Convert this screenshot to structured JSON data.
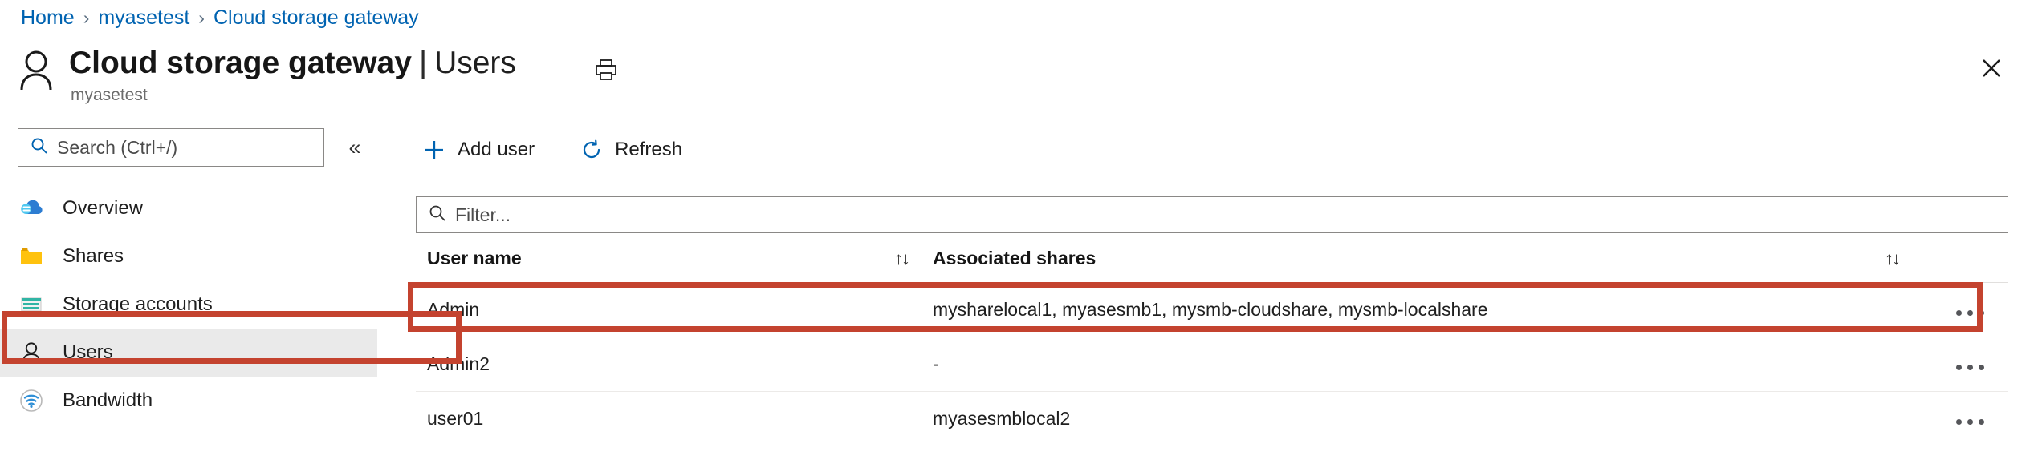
{
  "breadcrumb": {
    "items": [
      {
        "label": "Home"
      },
      {
        "label": "myasetest"
      },
      {
        "label": "Cloud storage gateway"
      }
    ],
    "separator": "›"
  },
  "header": {
    "resource_icon": "person-icon",
    "title": "Cloud storage gateway",
    "title_separator": "|",
    "page_name": "Users",
    "subtitle": "myasetest",
    "print_icon": "print-icon",
    "close_icon": "close-icon"
  },
  "sidebar": {
    "search": {
      "placeholder": "Search (Ctrl+/)",
      "icon": "search-icon"
    },
    "collapse_icon": "«",
    "items": [
      {
        "label": "Overview",
        "icon": "cloud-icon",
        "selected": false
      },
      {
        "label": "Shares",
        "icon": "folder-icon",
        "selected": false
      },
      {
        "label": "Storage accounts",
        "icon": "storage-account-icon",
        "selected": false
      },
      {
        "label": "Users",
        "icon": "person-icon",
        "selected": true
      },
      {
        "label": "Bandwidth",
        "icon": "bandwidth-icon",
        "selected": false
      }
    ]
  },
  "toolbar": {
    "add_user_label": "Add user",
    "add_user_icon": "plus-icon",
    "refresh_label": "Refresh",
    "refresh_icon": "refresh-icon"
  },
  "filter": {
    "placeholder": "Filter...",
    "icon": "search-icon"
  },
  "table": {
    "columns": [
      {
        "label": "User name",
        "sort_icon": "↑↓"
      },
      {
        "label": "Associated shares",
        "sort_icon": "↑↓"
      }
    ],
    "row_menu_icon": "more-options-icon",
    "rows": [
      {
        "user_name": "Admin",
        "associated_shares": "mysharelocal1, myasesmb1, mysmb-cloudshare, mysmb-localshare",
        "highlighted": false
      },
      {
        "user_name": "Admin2",
        "associated_shares": "-",
        "highlighted": true
      },
      {
        "user_name": "user01",
        "associated_shares": "myasesmblocal2",
        "highlighted": false
      }
    ]
  },
  "highlight": {
    "color": "#c4432f"
  }
}
